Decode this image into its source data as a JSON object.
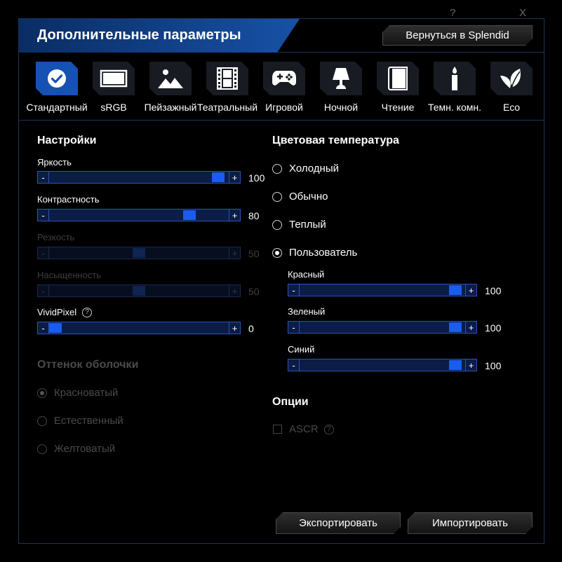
{
  "window": {
    "help": "?",
    "close": "X"
  },
  "header": {
    "title": "Дополнительные параметры",
    "back_label": "Вернуться в Splendid"
  },
  "modes": [
    {
      "label": "Стандартный",
      "icon": "check-icon",
      "active": true
    },
    {
      "label": "sRGB",
      "icon": "monitor-icon"
    },
    {
      "label": "Пейзажный",
      "icon": "landscape-icon"
    },
    {
      "label": "Театральный",
      "icon": "film-icon"
    },
    {
      "label": "Игровой",
      "icon": "gamepad-icon"
    },
    {
      "label": "Ночной",
      "icon": "lamp-icon"
    },
    {
      "label": "Чтение",
      "icon": "book-icon"
    },
    {
      "label": "Темн. комн.",
      "icon": "candle-icon"
    },
    {
      "label": "Eco",
      "icon": "leaf-icon"
    }
  ],
  "settings": {
    "title": "Настройки",
    "brightness": {
      "label": "Яркость",
      "value": "100"
    },
    "contrast": {
      "label": "Контрастность",
      "value": "80"
    },
    "sharpness": {
      "label": "Резкость",
      "value": "50"
    },
    "saturation": {
      "label": "Насыщенность",
      "value": "50"
    },
    "vividpixel": {
      "label": "VividPixel",
      "value": "0",
      "help": "?"
    }
  },
  "skin_tone": {
    "title": "Оттенок оболочки",
    "options": [
      "Красноватый",
      "Естественный",
      "Желтоватый"
    ],
    "selected": 0
  },
  "color_temp": {
    "title": "Цветовая температура",
    "options": [
      "Холодный",
      "Обычно",
      "Теплый",
      "Пользователь"
    ],
    "selected": 3,
    "red": {
      "label": "Красный",
      "value": "100"
    },
    "green": {
      "label": "Зеленый",
      "value": "100"
    },
    "blue": {
      "label": "Синий",
      "value": "100"
    }
  },
  "options": {
    "title": "Опции",
    "ascr": {
      "label": "ASCR",
      "help": "?"
    }
  },
  "slider_buttons": {
    "minus": "-",
    "plus": "+"
  },
  "footer": {
    "export_label": "Экспортировать",
    "import_label": "Импортировать"
  },
  "colors": {
    "accent": "#1a5bf0",
    "header_band": "#1751a6",
    "border": "#1e3358"
  }
}
